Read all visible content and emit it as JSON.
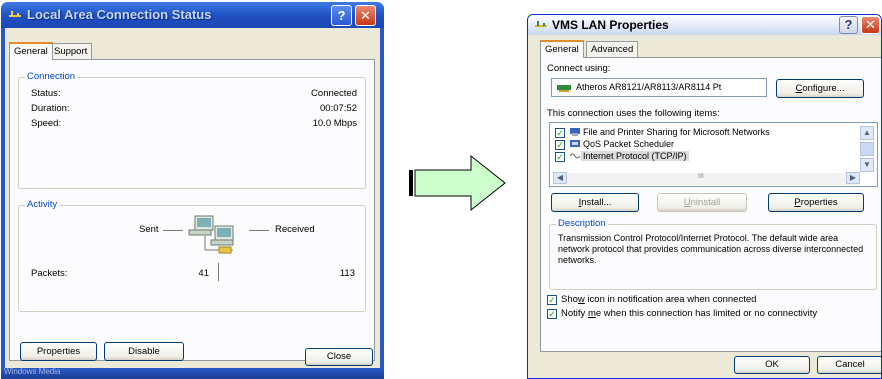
{
  "left_window": {
    "title": "Local Area Connection Status",
    "help_label": "?",
    "close_label": "✕",
    "tabs": [
      "General",
      "Support"
    ],
    "connection": {
      "label": "Connection",
      "rows": [
        {
          "label": "Status:",
          "value": "Connected"
        },
        {
          "label": "Duration:",
          "value": "00:07:52"
        },
        {
          "label": "Speed:",
          "value": "10.0 Mbps"
        }
      ]
    },
    "activity": {
      "label": "Activity",
      "sent_label": "Sent",
      "received_label": "Received",
      "packets_label": "Packets:",
      "packets_sent": "41",
      "packets_received": "113"
    },
    "buttons": {
      "properties": "Properties",
      "disable": "Disable",
      "close": "Close"
    },
    "status_text": "Windows Media"
  },
  "arrow": {
    "color": "#ccffcc",
    "icon": "right-arrow"
  },
  "right_window": {
    "title": "VMS LAN Properties",
    "help_label": "?",
    "close_label": "✕",
    "tabs": [
      "General",
      "Advanced"
    ],
    "connect_using_label": "Connect using:",
    "adapter_name": "Atheros AR8121/AR8113/AR8114 Pt",
    "configure_label": "Configure...",
    "items_label": "This connection uses the following items:",
    "items": [
      {
        "label": "File and Printer Sharing for Microsoft Networks",
        "checked": true,
        "icon": "printer-share-icon"
      },
      {
        "label": "QoS Packet Scheduler",
        "checked": true,
        "icon": "scheduler-icon"
      },
      {
        "label": "Internet Protocol (TCP/IP)",
        "checked": true,
        "icon": "protocol-icon"
      }
    ],
    "scroll_mid": "III",
    "buttons": {
      "install": "Install...",
      "uninstall": "Uninstall",
      "properties": "Properties"
    },
    "description_label": "Description",
    "description_text": "Transmission Control Protocol/Internet Protocol. The default wide area network protocol that provides communication across diverse interconnected networks.",
    "show_icon_label": "Show icon in notification area when connected",
    "notify_label": "Notify me when this connection has limited or no connectivity",
    "ok_label": "OK",
    "cancel_label": "Cancel"
  }
}
